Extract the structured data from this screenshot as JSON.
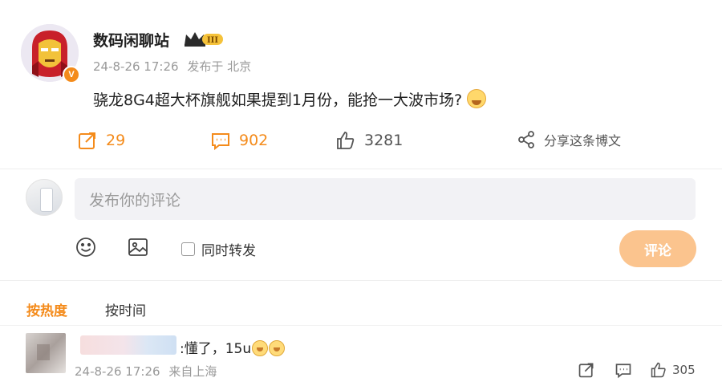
{
  "post": {
    "username": "数码闲聊站",
    "level_badge": "III",
    "verified_mark": "V",
    "date": "24-8-26 17:26",
    "location": "发布于 北京",
    "content": "骁龙8G4超大杯旗舰如果提到1月份，能抢一大波市场?",
    "actions": {
      "repost_count": "29",
      "comment_count": "902",
      "like_count": "3281",
      "share_label": "分享这条博文"
    }
  },
  "comment_box": {
    "placeholder": "发布你的评论",
    "repost_label": "同时转发",
    "submit_label": "评论"
  },
  "sort_tabs": {
    "hot": "按热度",
    "time": "按时间"
  },
  "comments": [
    {
      "text": ":懂了，15u",
      "date": "24-8-26 17:26",
      "location": "来自上海",
      "like_count": "305"
    }
  ],
  "colors": {
    "accent": "#f48b1b",
    "submit_disabled": "#fbc48e",
    "input_bg": "#f2f2f5",
    "meta_text": "#999999"
  },
  "icons": [
    "avatar-iron-man",
    "verified-icon",
    "crown-level-icon",
    "repost-icon",
    "comment-icon",
    "like-icon",
    "share-icon",
    "emoji-icon",
    "image-icon"
  ]
}
